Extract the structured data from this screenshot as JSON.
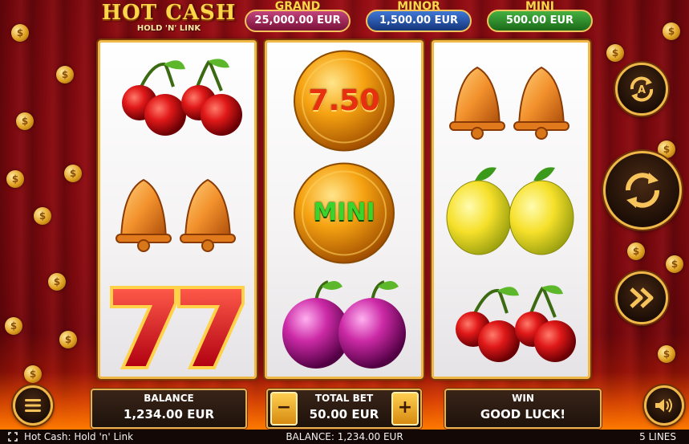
{
  "game": {
    "logo_title": "HOT CASH",
    "logo_subtitle": "HOLD 'N' LINK"
  },
  "jackpots": [
    {
      "label": "GRAND",
      "value": "25,000.00 EUR",
      "color": "#a51c55"
    },
    {
      "label": "MINOR",
      "value": "1,500.00 EUR",
      "color": "#1f4ea8"
    },
    {
      "label": "MINI",
      "value": "500.00 EUR",
      "color": "#2a8a28"
    }
  ],
  "reels": [
    [
      "cherries",
      "bells",
      "sevens"
    ],
    [
      "coin-value",
      "coin-mini",
      "plums"
    ],
    [
      "bells",
      "lemons",
      "cherries"
    ]
  ],
  "coins": {
    "value_label": "7.50",
    "mini_label": "MINI"
  },
  "panels": {
    "balance_label": "BALANCE",
    "balance_value": "1,234.00 EUR",
    "bet_label": "TOTAL BET",
    "bet_value": "50.00 EUR",
    "bet_minus": "−",
    "bet_plus": "+",
    "win_label": "WIN",
    "win_value": "GOOD LUCK!"
  },
  "footer": {
    "game_name": "Hot Cash: Hold 'n' Link",
    "balance": "BALANCE: 1,234.00 EUR",
    "lines": "5 LINES"
  },
  "icons": [
    "fullscreen-icon",
    "autoplay-icon",
    "spin-icon",
    "turbo-icon",
    "menu-icon",
    "sound-icon"
  ]
}
